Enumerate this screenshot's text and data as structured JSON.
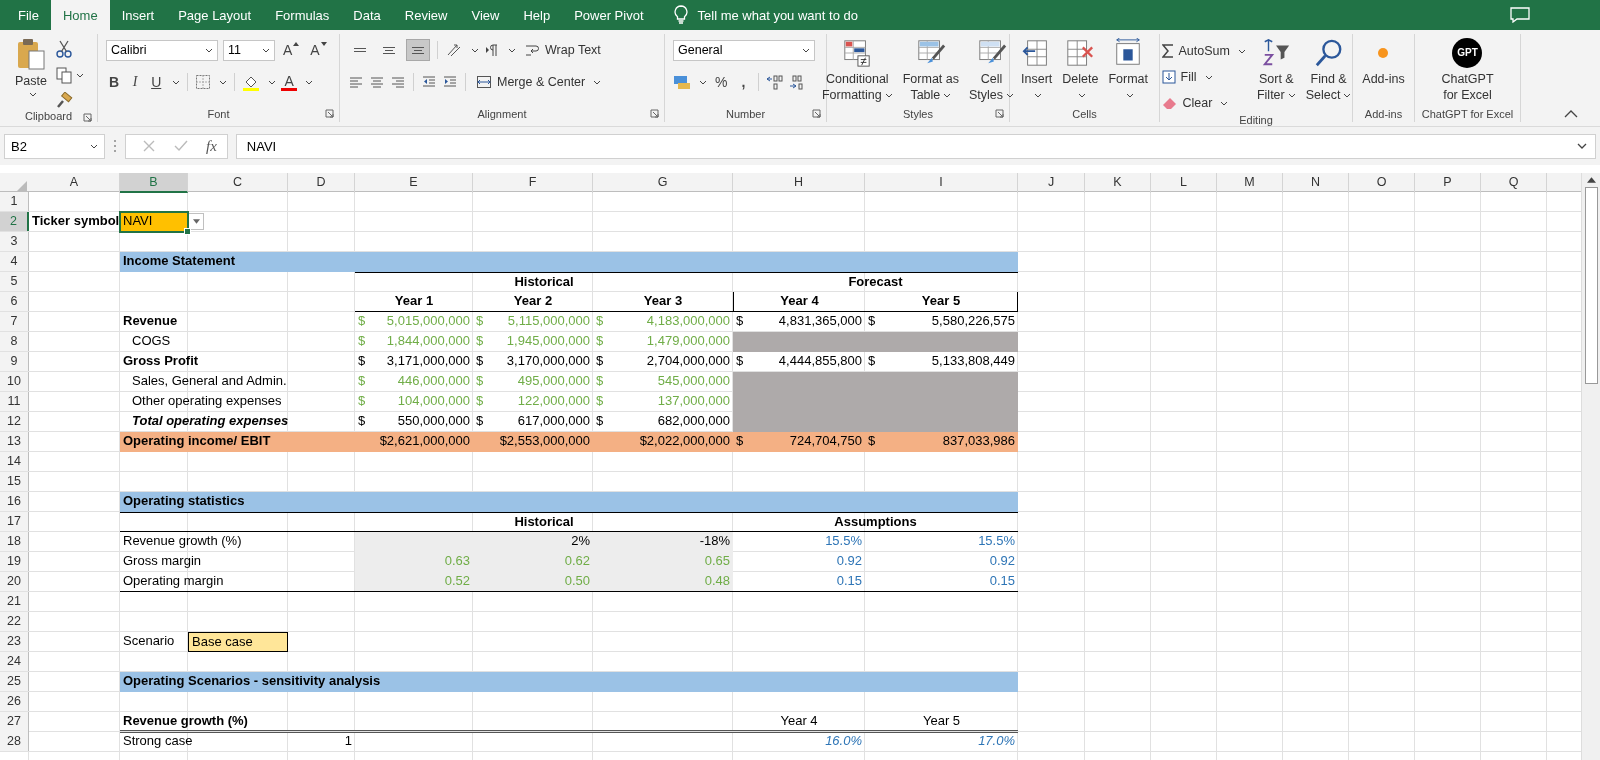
{
  "tabs": [
    {
      "label": "File",
      "selected": false
    },
    {
      "label": "Home",
      "selected": true
    },
    {
      "label": "Insert",
      "selected": false
    },
    {
      "label": "Page Layout",
      "selected": false
    },
    {
      "label": "Formulas",
      "selected": false
    },
    {
      "label": "Data",
      "selected": false
    },
    {
      "label": "Review",
      "selected": false
    },
    {
      "label": "View",
      "selected": false
    },
    {
      "label": "Help",
      "selected": false
    },
    {
      "label": "Power Pivot",
      "selected": false
    }
  ],
  "tell_me": "Tell me what you want to do",
  "ribbon": {
    "clipboard": {
      "label": "Clipboard",
      "paste": "Paste"
    },
    "font": {
      "label": "Font",
      "family": "Calibri",
      "size": "11",
      "grow": "A",
      "shrink": "A",
      "bold": "B",
      "italic": "I",
      "underline": "U",
      "color_letter": "A"
    },
    "alignment": {
      "label": "Alignment",
      "vertical": [
        {
          "selected": false
        },
        {
          "selected": false
        },
        {
          "selected": true
        }
      ],
      "wrap": "Wrap Text",
      "merge": "Merge & Center"
    },
    "number": {
      "label": "Number",
      "format": "General",
      "percent": "%",
      "comma": ","
    },
    "styles": {
      "label": "Styles",
      "buttons": [
        {
          "lines": [
            "Conditional",
            "Formatting"
          ]
        },
        {
          "lines": [
            "Format as",
            "Table"
          ]
        },
        {
          "lines": [
            "Cell",
            "Styles"
          ]
        }
      ]
    },
    "cells": {
      "label": "Cells",
      "buttons": [
        {
          "lines": [
            "Insert"
          ]
        },
        {
          "lines": [
            "Delete"
          ]
        },
        {
          "lines": [
            "Format"
          ]
        }
      ]
    },
    "editing": {
      "label": "Editing",
      "autosum": "AutoSum",
      "fill": "Fill",
      "clear": "Clear",
      "sort": [
        "Sort &",
        "Filter"
      ],
      "find": [
        "Find &",
        "Select"
      ]
    },
    "addins": {
      "label": "Add-ins",
      "button": "Add-ins"
    },
    "chatgpt": {
      "label": "ChatGPT for Excel",
      "logo": "GPT",
      "lines": [
        "ChatGPT",
        "for Excel"
      ]
    }
  },
  "formula_bar": {
    "name_box": "B2",
    "fx": "fx",
    "formula": "NAVI"
  },
  "sheet": {
    "columns": [
      {
        "letter": "A",
        "selected": false
      },
      {
        "letter": "B",
        "selected": true
      },
      {
        "letter": "C",
        "selected": false
      },
      {
        "letter": "D",
        "selected": false
      },
      {
        "letter": "E",
        "selected": false
      },
      {
        "letter": "F",
        "selected": false
      },
      {
        "letter": "G",
        "selected": false
      },
      {
        "letter": "H",
        "selected": false
      },
      {
        "letter": "I",
        "selected": false
      },
      {
        "letter": "J",
        "selected": false
      },
      {
        "letter": "K",
        "selected": false
      },
      {
        "letter": "L",
        "selected": false
      },
      {
        "letter": "M",
        "selected": false
      },
      {
        "letter": "N",
        "selected": false
      },
      {
        "letter": "O",
        "selected": false
      },
      {
        "letter": "P",
        "selected": false
      },
      {
        "letter": "Q",
        "selected": false
      }
    ],
    "row_numbers": [
      {
        "num": "1",
        "selected": false
      },
      {
        "num": "2",
        "selected": true
      },
      {
        "num": "3",
        "selected": false
      },
      {
        "num": "4",
        "selected": false
      },
      {
        "num": "5",
        "selected": false
      },
      {
        "num": "6",
        "selected": false
      },
      {
        "num": "7",
        "selected": false
      },
      {
        "num": "8",
        "selected": false
      },
      {
        "num": "9",
        "selected": false
      },
      {
        "num": "10",
        "selected": false
      },
      {
        "num": "11",
        "selected": false
      },
      {
        "num": "12",
        "selected": false
      },
      {
        "num": "13",
        "selected": false
      },
      {
        "num": "14",
        "selected": false
      },
      {
        "num": "15",
        "selected": false
      },
      {
        "num": "16",
        "selected": false
      },
      {
        "num": "17",
        "selected": false
      },
      {
        "num": "18",
        "selected": false
      },
      {
        "num": "19",
        "selected": false
      },
      {
        "num": "20",
        "selected": false
      },
      {
        "num": "21",
        "selected": false
      },
      {
        "num": "22",
        "selected": false
      },
      {
        "num": "23",
        "selected": false
      },
      {
        "num": "24",
        "selected": false
      },
      {
        "num": "25",
        "selected": false
      },
      {
        "num": "26",
        "selected": false
      },
      {
        "num": "27",
        "selected": false
      },
      {
        "num": "28",
        "selected": false
      }
    ],
    "ticker": {
      "label": "Ticker symbol",
      "value": "NAVI",
      "selected": true
    },
    "income_statement": {
      "title": "Income Statement",
      "periods": [
        {
          "label": "Historical",
          "years": [
            "Year 1",
            "Year 2",
            "Year 3"
          ]
        },
        {
          "label": "Forecast",
          "years": [
            "Year 4",
            "Year 5"
          ]
        }
      ],
      "lines": [
        {
          "label": "Revenue",
          "kind": "heading",
          "values": [
            {
              "currency": "$",
              "text": "5,015,000,000",
              "kind": "input"
            },
            {
              "currency": "$",
              "text": "5,115,000,000",
              "kind": "input"
            },
            {
              "currency": "$",
              "text": "4,183,000,000",
              "kind": "input"
            },
            {
              "currency": "$",
              "text": "4,831,365,000",
              "kind": "formula"
            },
            {
              "currency": "$",
              "text": "5,580,226,575",
              "kind": "formula"
            }
          ]
        },
        {
          "label": "COGS",
          "kind": "item",
          "values": [
            {
              "currency": "$",
              "text": "1,844,000,000",
              "kind": "input"
            },
            {
              "currency": "$",
              "text": "1,945,000,000",
              "kind": "input"
            },
            {
              "currency": "$",
              "text": "1,479,000,000",
              "kind": "input"
            },
            {
              "kind": "blank"
            },
            {
              "kind": "blank"
            }
          ]
        },
        {
          "label": "Gross Profit",
          "kind": "heading",
          "values": [
            {
              "currency": "$",
              "text": "3,171,000,000",
              "kind": "formula"
            },
            {
              "currency": "$",
              "text": "3,170,000,000",
              "kind": "formula"
            },
            {
              "currency": "$",
              "text": "2,704,000,000",
              "kind": "formula"
            },
            {
              "currency": "$",
              "text": "4,444,855,800",
              "kind": "formula"
            },
            {
              "currency": "$",
              "text": "5,133,808,449",
              "kind": "formula"
            }
          ]
        },
        {
          "label": "Sales, General and Admin.",
          "kind": "item",
          "values": [
            {
              "currency": "$",
              "text": "446,000,000",
              "kind": "input"
            },
            {
              "currency": "$",
              "text": "495,000,000",
              "kind": "input"
            },
            {
              "currency": "$",
              "text": "545,000,000",
              "kind": "input"
            },
            {
              "kind": "blank"
            },
            {
              "kind": "blank"
            }
          ]
        },
        {
          "label": "Other operating expenses",
          "kind": "item",
          "values": [
            {
              "currency": "$",
              "text": "104,000,000",
              "kind": "input"
            },
            {
              "currency": "$",
              "text": "122,000,000",
              "kind": "input"
            },
            {
              "currency": "$",
              "text": "137,000,000",
              "kind": "input"
            },
            {
              "kind": "blank"
            },
            {
              "kind": "blank"
            }
          ]
        },
        {
          "label": "Total operating expenses",
          "kind": "subtotal",
          "values": [
            {
              "currency": "$",
              "text": "550,000,000",
              "kind": "formula"
            },
            {
              "currency": "$",
              "text": "617,000,000",
              "kind": "formula"
            },
            {
              "currency": "$",
              "text": "682,000,000",
              "kind": "formula"
            },
            {
              "kind": "blank"
            },
            {
              "kind": "blank"
            }
          ]
        },
        {
          "label": "Operating income/ EBIT",
          "kind": "total",
          "values": [
            {
              "text": "$2,621,000,000",
              "kind": "formula"
            },
            {
              "text": "$2,553,000,000",
              "kind": "formula"
            },
            {
              "text": "$2,022,000,000",
              "kind": "formula"
            },
            {
              "currency": "$",
              "text": "724,704,750",
              "kind": "formula"
            },
            {
              "currency": "$",
              "text": "837,033,986",
              "kind": "formula"
            }
          ]
        }
      ]
    },
    "operating_statistics": {
      "title": "Operating statistics",
      "headers": [
        "Historical",
        "Assumptions"
      ],
      "lines": [
        {
          "label": "Revenue growth (%)",
          "values": [
            {
              "kind": "blank"
            },
            {
              "text": "2%",
              "kind": "formula"
            },
            {
              "text": "-18%",
              "kind": "formula"
            },
            {
              "text": "15.5%",
              "kind": "assumption"
            },
            {
              "text": "15.5%",
              "kind": "assumption"
            }
          ]
        },
        {
          "label": "Gross margin",
          "values": [
            {
              "text": "0.63",
              "kind": "input"
            },
            {
              "text": "0.62",
              "kind": "input"
            },
            {
              "text": "0.65",
              "kind": "input"
            },
            {
              "text": "0.92",
              "kind": "assumption"
            },
            {
              "text": "0.92",
              "kind": "assumption"
            }
          ]
        },
        {
          "label": "Operating margin",
          "values": [
            {
              "text": "0.52",
              "kind": "input"
            },
            {
              "text": "0.50",
              "kind": "input"
            },
            {
              "text": "0.48",
              "kind": "input"
            },
            {
              "text": "0.15",
              "kind": "assumption"
            },
            {
              "text": "0.15",
              "kind": "assumption"
            }
          ]
        }
      ]
    },
    "scenario": {
      "label": "Scenario",
      "value": "Base case"
    },
    "scenarios": {
      "title": "Operating Scenarios - sensitivity analysis",
      "heading": "Revenue growth (%)",
      "years": [
        "Year 4",
        "Year 5"
      ],
      "rows": [
        {
          "label": "Strong case",
          "number": "1",
          "values": [
            "16.0%",
            "17.0%"
          ]
        }
      ]
    }
  }
}
